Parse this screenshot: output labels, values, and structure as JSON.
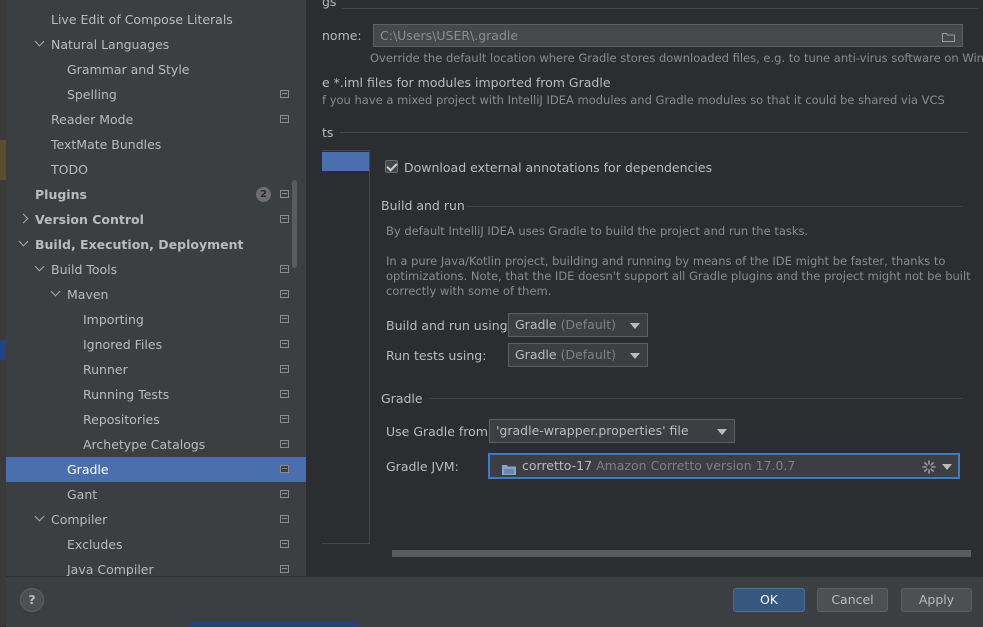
{
  "sidebar": {
    "items": [
      {
        "label": "Live Edit of Compose Literals",
        "indent": 2,
        "chevron": "",
        "bold": false,
        "selected": false,
        "page_icon": false
      },
      {
        "label": "Natural Languages",
        "indent": 2,
        "chevron": "down",
        "bold": false,
        "selected": false,
        "page_icon": false
      },
      {
        "label": "Grammar and Style",
        "indent": 3,
        "chevron": "",
        "bold": false,
        "selected": false,
        "page_icon": false
      },
      {
        "label": "Spelling",
        "indent": 3,
        "chevron": "",
        "bold": false,
        "selected": false,
        "page_icon": true
      },
      {
        "label": "Reader Mode",
        "indent": 2,
        "chevron": "",
        "bold": false,
        "selected": false,
        "page_icon": true
      },
      {
        "label": "TextMate Bundles",
        "indent": 2,
        "chevron": "",
        "bold": false,
        "selected": false,
        "page_icon": false
      },
      {
        "label": "TODO",
        "indent": 2,
        "chevron": "",
        "bold": false,
        "selected": false,
        "page_icon": false
      },
      {
        "label": "Plugins",
        "indent": 1,
        "chevron": "",
        "bold": true,
        "selected": false,
        "page_icon": true,
        "badge": "2"
      },
      {
        "label": "Version Control",
        "indent": 1,
        "chevron": "right",
        "bold": true,
        "selected": false,
        "page_icon": true
      },
      {
        "label": "Build, Execution, Deployment",
        "indent": 1,
        "chevron": "down",
        "bold": true,
        "selected": false,
        "page_icon": false
      },
      {
        "label": "Build Tools",
        "indent": 2,
        "chevron": "down",
        "bold": false,
        "selected": false,
        "page_icon": true
      },
      {
        "label": "Maven",
        "indent": 3,
        "chevron": "down",
        "bold": false,
        "selected": false,
        "page_icon": true
      },
      {
        "label": "Importing",
        "indent": 4,
        "chevron": "",
        "bold": false,
        "selected": false,
        "page_icon": true
      },
      {
        "label": "Ignored Files",
        "indent": 4,
        "chevron": "",
        "bold": false,
        "selected": false,
        "page_icon": true
      },
      {
        "label": "Runner",
        "indent": 4,
        "chevron": "",
        "bold": false,
        "selected": false,
        "page_icon": true
      },
      {
        "label": "Running Tests",
        "indent": 4,
        "chevron": "",
        "bold": false,
        "selected": false,
        "page_icon": true
      },
      {
        "label": "Repositories",
        "indent": 4,
        "chevron": "",
        "bold": false,
        "selected": false,
        "page_icon": true
      },
      {
        "label": "Archetype Catalogs",
        "indent": 4,
        "chevron": "",
        "bold": false,
        "selected": false,
        "page_icon": true
      },
      {
        "label": "Gradle",
        "indent": 3,
        "chevron": "",
        "bold": false,
        "selected": true,
        "page_icon": true
      },
      {
        "label": "Gant",
        "indent": 3,
        "chevron": "",
        "bold": false,
        "selected": false,
        "page_icon": true
      },
      {
        "label": "Compiler",
        "indent": 2,
        "chevron": "down",
        "bold": false,
        "selected": false,
        "page_icon": true
      },
      {
        "label": "Excludes",
        "indent": 3,
        "chevron": "",
        "bold": false,
        "selected": false,
        "page_icon": true
      },
      {
        "label": "Java Compiler",
        "indent": 3,
        "chevron": "",
        "bold": false,
        "selected": false,
        "page_icon": true
      }
    ]
  },
  "main": {
    "section_top_cut": "gs",
    "user_home_label": "nome:",
    "user_home_value": "C:\\Users\\USER\\.gradle",
    "user_home_hint": "Override the default location where Gradle stores downloaded files, e.g. to tune anti-virus software on Windows",
    "iml_label": "e *.iml files for modules imported from Gradle",
    "iml_hint": "f you have a mixed project with IntelliJ IDEA modules and Gradle modules so that it could be shared via VCS",
    "projects_section_cut": "ts",
    "download_annotations_label": "Download external annotations for dependencies",
    "build_and_run_title": "Build and run",
    "build_and_run_desc1": "By default IntelliJ IDEA uses Gradle to build the project and run the tasks.",
    "build_and_run_desc2_l1": "In a pure Java/Kotlin project, building and running by means of the IDE might be faster, thanks to",
    "build_and_run_desc2_l2": "optimizations. Note, that the IDE doesn't support all Gradle plugins and the project might not be built",
    "build_and_run_desc2_l3": "correctly with some of them.",
    "build_run_using_label": "Build and run using:",
    "build_run_using_value": "Gradle",
    "build_run_using_hint": "(Default)",
    "run_tests_using_label": "Run tests using:",
    "run_tests_using_value": "Gradle",
    "run_tests_using_hint": "(Default)",
    "gradle_title": "Gradle",
    "use_gradle_from_label": "Use Gradle from:",
    "use_gradle_from_value": "'gradle-wrapper.properties' file",
    "gradle_jvm_label": "Gradle JVM:",
    "gradle_jvm_value": "corretto-17",
    "gradle_jvm_hint": "Amazon Corretto version 17.0.7"
  },
  "footer": {
    "help_label": "?",
    "ok_label": "OK",
    "cancel_label": "Cancel",
    "apply_label": "Apply"
  },
  "colors": {
    "selection": "#4b6eaf",
    "primary_button": "#365880",
    "focus_border": "#3d7ac8"
  }
}
